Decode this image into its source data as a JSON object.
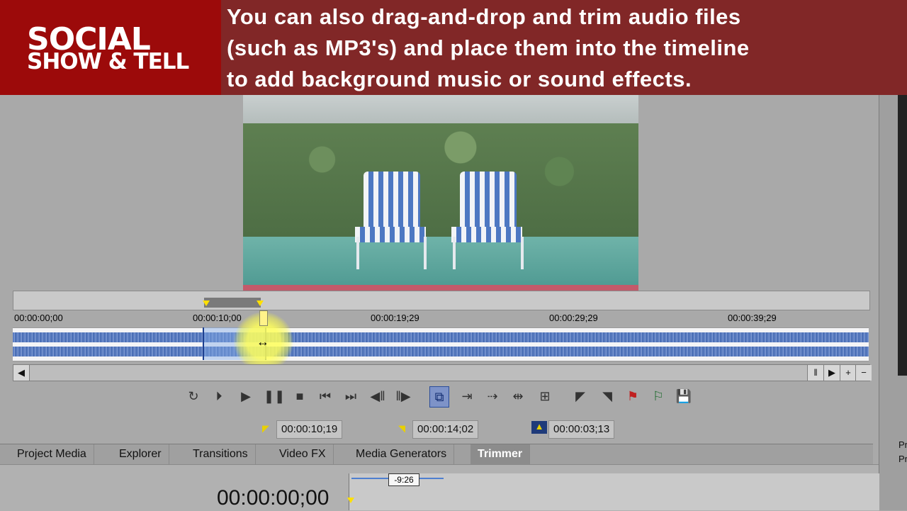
{
  "brand": {
    "line1": "SOCIAL",
    "line2": "SHOW & TELL"
  },
  "caption": {
    "lines": [
      "You can also drag-and-drop and trim audio files",
      "(such as MP3's) and place them into the timeline",
      "to add background music or sound effects."
    ]
  },
  "timeline": {
    "ruler_labels": [
      "00:00:00;00",
      "00:00:10;00",
      "00:00:19;29",
      "00:00:29;29",
      "00:00:39;29"
    ]
  },
  "time_fields": {
    "in_point": "00:00:10;19",
    "out_point": "00:00:14;02",
    "duration": "00:00:03;13"
  },
  "tabs": [
    {
      "label": "Project Media"
    },
    {
      "label": "Explorer"
    },
    {
      "label": "Transitions"
    },
    {
      "label": "Video FX"
    },
    {
      "label": "Media Generators"
    },
    {
      "label": "Trimmer",
      "active": true
    }
  ],
  "bottom": {
    "timecode": "00:00:00;00",
    "offset_badge": "-9:26"
  },
  "right_panel": {
    "labels": [
      "Pr",
      "Pr"
    ]
  },
  "icons": {
    "loop": "loop-icon",
    "play_start": "play-from-start-icon",
    "play": "play-icon",
    "pause": "pause-icon",
    "stop": "stop-icon",
    "prev": "go-to-start-icon",
    "next": "go-to-end-icon",
    "prev_frame": "previous-frame-icon",
    "next_frame": "next-frame-icon"
  },
  "colors": {
    "brand_red": "#9c0a0a",
    "wave_blue": "#5e7fc2",
    "highlight_yellow": "#ffe000"
  }
}
